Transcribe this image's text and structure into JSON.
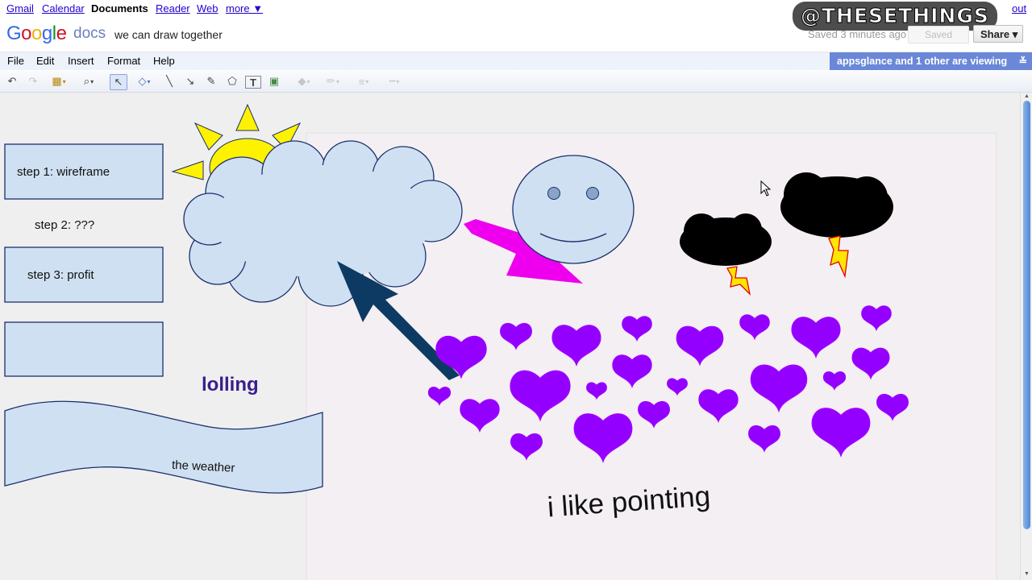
{
  "topnav": {
    "gmail": "Gmail",
    "calendar": "Calendar",
    "documents": "Documents",
    "reader": "Reader",
    "web": "Web",
    "more": "more ▼",
    "signout_partial": "out"
  },
  "watermark": "@THESETHINGS",
  "header": {
    "logo": [
      "G",
      "o",
      "o",
      "g",
      "l",
      "e"
    ],
    "docs": "docs",
    "title": "we can draw together",
    "saved_status": "Saved 3 minutes ago",
    "saved_button": "Saved",
    "share_button": "Share ▾"
  },
  "menu": {
    "file": "File",
    "edit": "Edit",
    "insert": "Insert",
    "format": "Format",
    "help": "Help"
  },
  "viewers": "appsglance and 1 other are viewing",
  "viewers_icon": "≚",
  "toolbar": {
    "undo": "↶",
    "redo": "↷",
    "clipart": "▦",
    "zoom": "⌕",
    "select": "↖",
    "shape": "◇",
    "line": "╲",
    "arrow": "↘",
    "scribble": "✎",
    "polyline": "⬠",
    "textbox": "T",
    "image": "▣",
    "fill": "◆",
    "stroke": "✏",
    "weight": "≡",
    "dash": "┅",
    "caret": "▾"
  },
  "drawing": {
    "step1": "step 1: wireframe",
    "step2": "step 2: ???",
    "step3": "step 3: profit",
    "lolling": "lolling",
    "weather": "the weather",
    "pointing": "i like pointing"
  },
  "colors": {
    "shape_fill": "#cfe0f2",
    "shape_stroke": "#1b2f6e",
    "sun": "#fff200",
    "magenta_arrow": "#ee00ee",
    "navy_arrow": "#0d3a62",
    "heart": "#9400ff",
    "lolling_text": "#3a1e8c"
  }
}
